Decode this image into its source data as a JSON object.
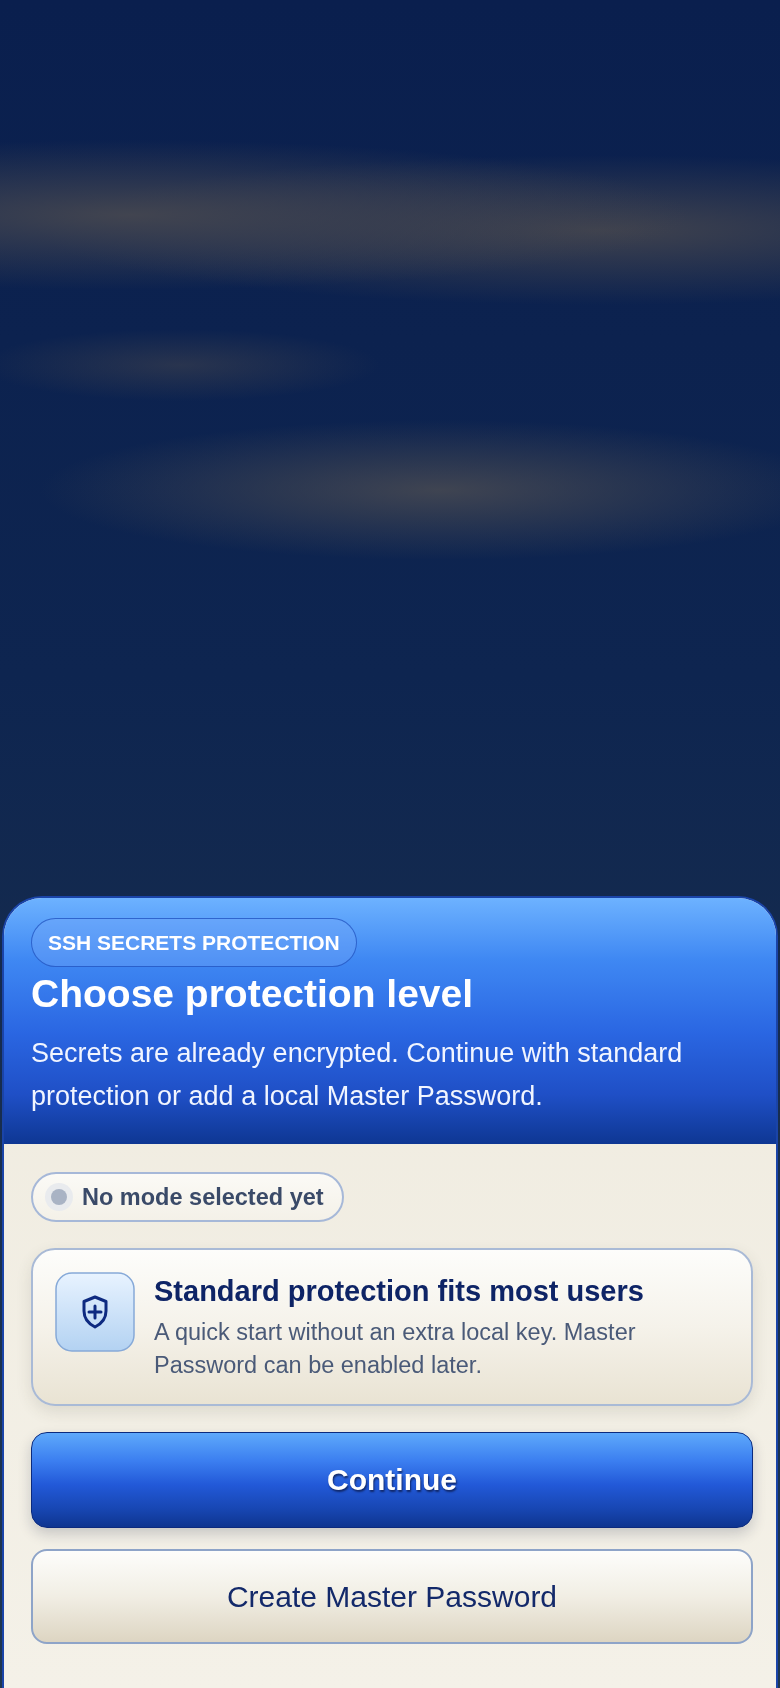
{
  "header": {
    "badge": "SSH SECRETS PROTECTION",
    "title": "Choose protection level",
    "description": "Secrets are already encrypted. Continue with standard protection or add a local Master Password."
  },
  "status": {
    "text": "No mode selected yet"
  },
  "recommendation": {
    "title": "Standard protection fits most users",
    "text": "A quick start without an extra local key. Master Password can be enabled later."
  },
  "buttons": [
    {
      "label": "Continue",
      "kind": "primary"
    },
    {
      "label": "Create Master Password",
      "kind": "secondary"
    }
  ]
}
